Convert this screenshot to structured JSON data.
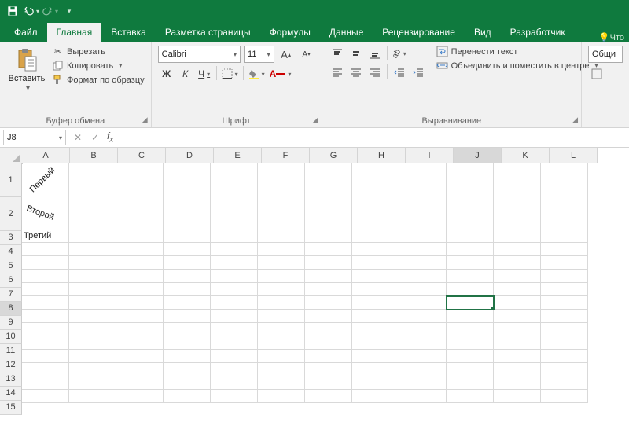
{
  "qat": {
    "save": "save",
    "undo": "undo",
    "redo": "redo",
    "custom": "custom"
  },
  "tabs": {
    "file": "Файл",
    "home": "Главная",
    "insert": "Вставка",
    "layout": "Разметка страницы",
    "formulas": "Формулы",
    "data": "Данные",
    "review": "Рецензирование",
    "view": "Вид",
    "developer": "Разработчик"
  },
  "tell": "Что",
  "ribbon": {
    "paste": "Вставить",
    "cut": "Вырезать",
    "copy": "Копировать",
    "format_painter": "Формат по образцу",
    "clipboard": "Буфер обмена",
    "font_name": "Calibri",
    "font_size": "11",
    "font": "Шрифт",
    "wrap": "Перенести текст",
    "merge": "Объединить и поместить в центре",
    "alignment": "Выравнивание",
    "general": "Общи"
  },
  "namebox": "J8",
  "columns": [
    "A",
    "B",
    "C",
    "D",
    "E",
    "F",
    "G",
    "H",
    "I",
    "J",
    "K",
    "L"
  ],
  "rows": {
    "heights": [
      42,
      42,
      17,
      17,
      17,
      17,
      17,
      17,
      17,
      17,
      17,
      17,
      17,
      17,
      17
    ],
    "labels": [
      "1",
      "2",
      "3",
      "4",
      "5",
      "6",
      "7",
      "8",
      "9",
      "10",
      "11",
      "12",
      "13",
      "14",
      "15"
    ]
  },
  "cellsA": {
    "1": "Первый",
    "2": "Второй",
    "3": "Третий"
  },
  "active": {
    "row": 8,
    "col": "J"
  }
}
